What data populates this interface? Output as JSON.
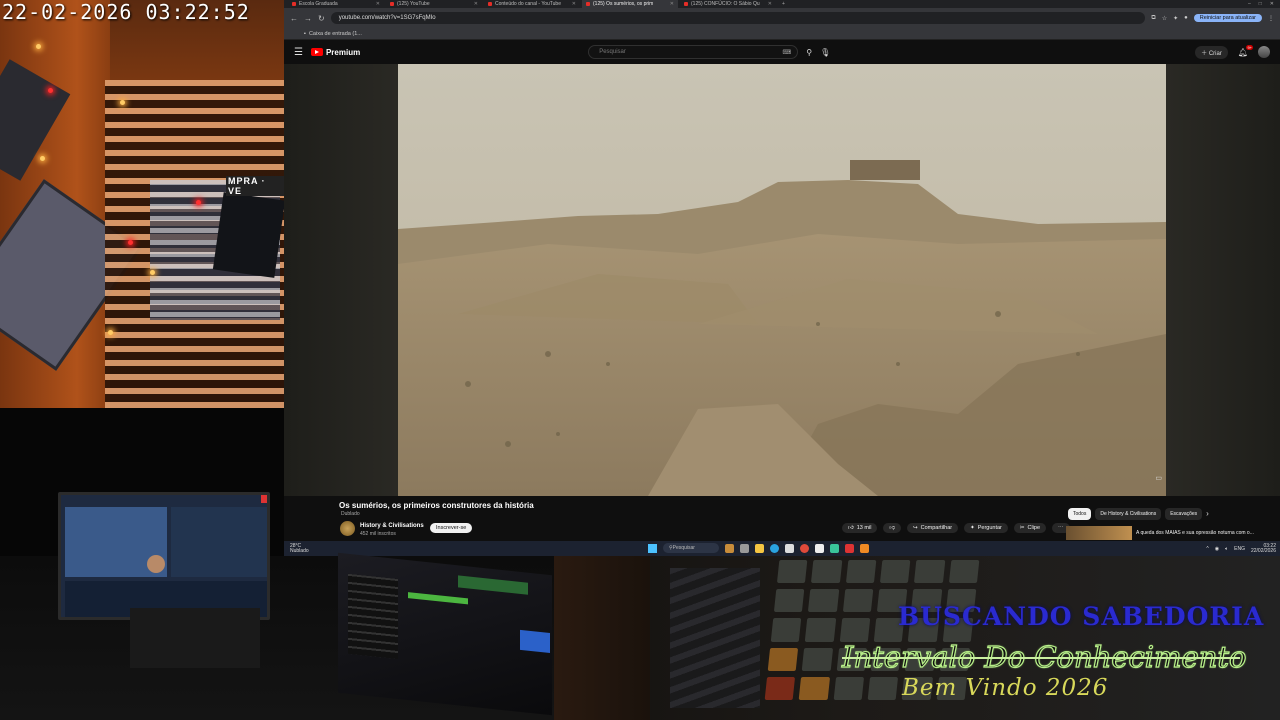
{
  "overlay": {
    "timestamp": "22-02-2026 03:22:52",
    "line1": "BUSCANDO SABEDORIA",
    "line2": "Intervalo Do Conhecimento",
    "line3": "Bem Vindo 2026"
  },
  "cam": {
    "sign_text": "MPRA · VE"
  },
  "browser": {
    "tabs": [
      {
        "label": "Escola Graduada",
        "active": false
      },
      {
        "label": "(125) YouTube",
        "active": false
      },
      {
        "label": "Conteúdo do canal - YouTube",
        "active": false
      },
      {
        "label": "(125) Os sumérios, os prim",
        "active": true
      },
      {
        "label": "(125) CONFÚCIO: O Sábio Qu",
        "active": false
      }
    ],
    "new_tab": "+",
    "url": "youtube.com/watch?v=1SG7sFqMIo",
    "restart_label": "Reiniciar para atualizar",
    "bookmark": "Caixa de entrada (1..."
  },
  "youtube": {
    "logo": "Premium",
    "search_placeholder": "Pesquisar",
    "create_label": "Criar",
    "notif_count": "9+",
    "video_title": "Os sumérios, os primeiros construtores da história",
    "dubbed": "Dublado",
    "channel_name": "History & Civilisations",
    "channel_subs": "452 mil inscritos",
    "subscribe_label": "Inscrever-se",
    "likes": "13 mil",
    "share_label": "Compartilhar",
    "ask_label": "Perguntar",
    "clip_label": "Clipe",
    "chips": [
      "Todos",
      "De History & Civilisations",
      "Escavações"
    ],
    "rec_title": "A queda dos MAIAS e sua opressão noturna com o..."
  },
  "taskbar": {
    "temp": "28°C",
    "weather": "Nublado",
    "search": "Pesquisar",
    "lang": "ENG",
    "time": "03:22",
    "date": "22/02/2026"
  },
  "colors": {
    "yt_red": "#ff0000",
    "overlay_blue": "#2a2ad0",
    "overlay_green": "#b8f08a",
    "overlay_yellow": "#d8d85a"
  }
}
